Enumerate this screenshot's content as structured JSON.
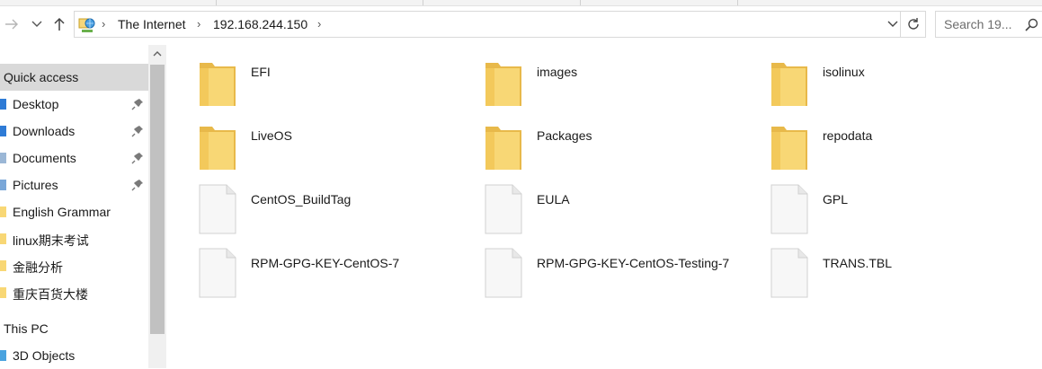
{
  "address": {
    "crumbs": [
      "The Internet",
      "192.168.244.150"
    ]
  },
  "search": {
    "placeholder": "Search 19..."
  },
  "sidebar": {
    "items": [
      {
        "label": "Quick access",
        "icon": "star-icon",
        "pinned": false,
        "selected": true,
        "header": true
      },
      {
        "label": "Desktop",
        "icon": "desktop-icon",
        "pinned": true
      },
      {
        "label": "Downloads",
        "icon": "download-icon",
        "pinned": true
      },
      {
        "label": "Documents",
        "icon": "documents-icon",
        "pinned": true
      },
      {
        "label": "Pictures",
        "icon": "pictures-icon",
        "pinned": true
      },
      {
        "label": "English Grammar",
        "icon": "folder-icon",
        "pinned": false
      },
      {
        "label": "linux期末考试",
        "icon": "folder-icon",
        "pinned": false
      },
      {
        "label": "金融分析",
        "icon": "folder-icon",
        "pinned": false
      },
      {
        "label": "重庆百货大楼",
        "icon": "folder-icon",
        "pinned": false
      },
      {
        "label": "This PC",
        "icon": "computer-icon",
        "pinned": false,
        "header": true
      },
      {
        "label": "3D Objects",
        "icon": "3d-objects-icon",
        "pinned": false
      }
    ]
  },
  "files": [
    {
      "name": "EFI",
      "type": "folder"
    },
    {
      "name": "images",
      "type": "folder"
    },
    {
      "name": "isolinux",
      "type": "folder"
    },
    {
      "name": "LiveOS",
      "type": "folder"
    },
    {
      "name": "Packages",
      "type": "folder"
    },
    {
      "name": "repodata",
      "type": "folder"
    },
    {
      "name": "CentOS_BuildTag",
      "type": "file"
    },
    {
      "name": "EULA",
      "type": "file"
    },
    {
      "name": "GPL",
      "type": "file"
    },
    {
      "name": "RPM-GPG-KEY-CentOS-7",
      "type": "file"
    },
    {
      "name": "RPM-GPG-KEY-CentOS-Testing-7",
      "type": "file"
    },
    {
      "name": "TRANS.TBL",
      "type": "file"
    }
  ],
  "colors": {
    "folder": "#f8d775",
    "folder_dark": "#e8b94a",
    "selection": "#d9d9d9",
    "pin": "#7a7a7a"
  }
}
